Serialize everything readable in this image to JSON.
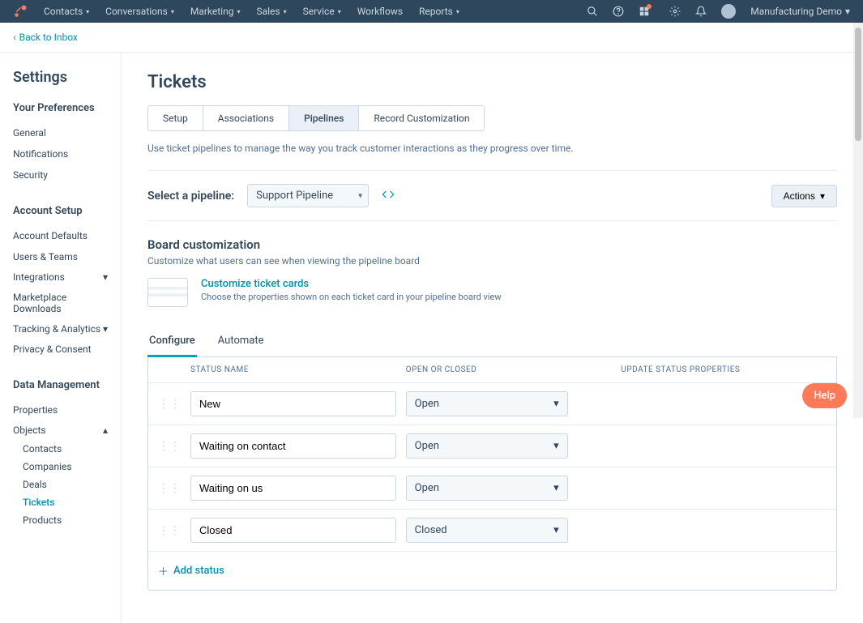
{
  "topnav": {
    "items": [
      "Contacts",
      "Conversations",
      "Marketing",
      "Sales",
      "Service",
      "Workflows",
      "Reports"
    ],
    "account": "Manufacturing Demo"
  },
  "backbar": {
    "label": "Back to Inbox"
  },
  "sidebar": {
    "title": "Settings",
    "sections": [
      {
        "title": "Your Preferences",
        "links": [
          "General",
          "Notifications",
          "Security"
        ]
      },
      {
        "title": "Account Setup",
        "links": [
          "Account Defaults",
          "Users & Teams",
          "Integrations",
          "Marketplace Downloads",
          "Tracking & Analytics",
          "Privacy & Consent"
        ]
      },
      {
        "title": "Data Management",
        "links": [
          "Properties"
        ],
        "expandable": {
          "label": "Objects",
          "children": [
            "Contacts",
            "Companies",
            "Deals",
            "Tickets",
            "Products"
          ],
          "active": "Tickets"
        }
      }
    ]
  },
  "main": {
    "title": "Tickets",
    "tabs": [
      "Setup",
      "Associations",
      "Pipelines",
      "Record Customization"
    ],
    "active_tab": "Pipelines",
    "description": "Use ticket pipelines to manage the way you track customer interactions as they progress over time.",
    "pipeline": {
      "label": "Select a pipeline:",
      "selected": "Support Pipeline",
      "actions_label": "Actions"
    },
    "board": {
      "title": "Board customization",
      "subtitle": "Customize what users can see when viewing the pipeline board",
      "card_link": "Customize ticket cards",
      "card_desc": "Choose the properties shown on each ticket card in your pipeline board view"
    },
    "subtabs": [
      "Configure",
      "Automate"
    ],
    "active_subtab": "Configure",
    "status_table": {
      "headers": [
        "STATUS NAME",
        "OPEN OR CLOSED",
        "UPDATE STATUS PROPERTIES"
      ],
      "rows": [
        {
          "name": "New",
          "state": "Open"
        },
        {
          "name": "Waiting on contact",
          "state": "Open"
        },
        {
          "name": "Waiting on us",
          "state": "Open"
        },
        {
          "name": "Closed",
          "state": "Closed"
        }
      ],
      "add_label": "Add status"
    }
  },
  "help": {
    "label": "Help"
  }
}
